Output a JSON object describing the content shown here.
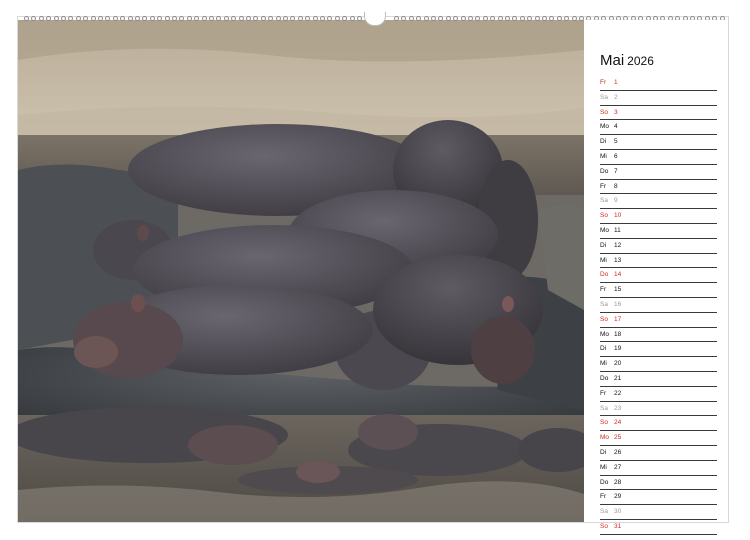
{
  "calendar": {
    "month": "Mai",
    "year": "2026",
    "days": [
      {
        "dn": "Fr",
        "num": "1",
        "kind": "sun"
      },
      {
        "dn": "Sa",
        "num": "2",
        "kind": "sat"
      },
      {
        "dn": "So",
        "num": "3",
        "kind": "sun"
      },
      {
        "dn": "Mo",
        "num": "4",
        "kind": "wd"
      },
      {
        "dn": "Di",
        "num": "5",
        "kind": "wd"
      },
      {
        "dn": "Mi",
        "num": "6",
        "kind": "wd"
      },
      {
        "dn": "Do",
        "num": "7",
        "kind": "wd"
      },
      {
        "dn": "Fr",
        "num": "8",
        "kind": "wd"
      },
      {
        "dn": "Sa",
        "num": "9",
        "kind": "sat"
      },
      {
        "dn": "So",
        "num": "10",
        "kind": "sun"
      },
      {
        "dn": "Mo",
        "num": "11",
        "kind": "wd"
      },
      {
        "dn": "Di",
        "num": "12",
        "kind": "wd"
      },
      {
        "dn": "Mi",
        "num": "13",
        "kind": "wd"
      },
      {
        "dn": "Do",
        "num": "14",
        "kind": "sun"
      },
      {
        "dn": "Fr",
        "num": "15",
        "kind": "wd"
      },
      {
        "dn": "Sa",
        "num": "16",
        "kind": "sat"
      },
      {
        "dn": "So",
        "num": "17",
        "kind": "sun"
      },
      {
        "dn": "Mo",
        "num": "18",
        "kind": "wd"
      },
      {
        "dn": "Di",
        "num": "19",
        "kind": "wd"
      },
      {
        "dn": "Mi",
        "num": "20",
        "kind": "wd"
      },
      {
        "dn": "Do",
        "num": "21",
        "kind": "wd"
      },
      {
        "dn": "Fr",
        "num": "22",
        "kind": "wd"
      },
      {
        "dn": "Sa",
        "num": "23",
        "kind": "sat"
      },
      {
        "dn": "So",
        "num": "24",
        "kind": "sun"
      },
      {
        "dn": "Mo",
        "num": "25",
        "kind": "sun"
      },
      {
        "dn": "Di",
        "num": "26",
        "kind": "wd"
      },
      {
        "dn": "Mi",
        "num": "27",
        "kind": "wd"
      },
      {
        "dn": "Do",
        "num": "28",
        "kind": "wd"
      },
      {
        "dn": "Fr",
        "num": "29",
        "kind": "wd"
      },
      {
        "dn": "Sa",
        "num": "30",
        "kind": "sat"
      },
      {
        "dn": "So",
        "num": "31",
        "kind": "sun"
      }
    ]
  },
  "colors": {
    "sunday_holiday": "#cc2a1e",
    "saturday": "#9a9a9a",
    "weekday": "#111111"
  },
  "photo": {
    "subject": "hippo-group-on-rocks"
  }
}
